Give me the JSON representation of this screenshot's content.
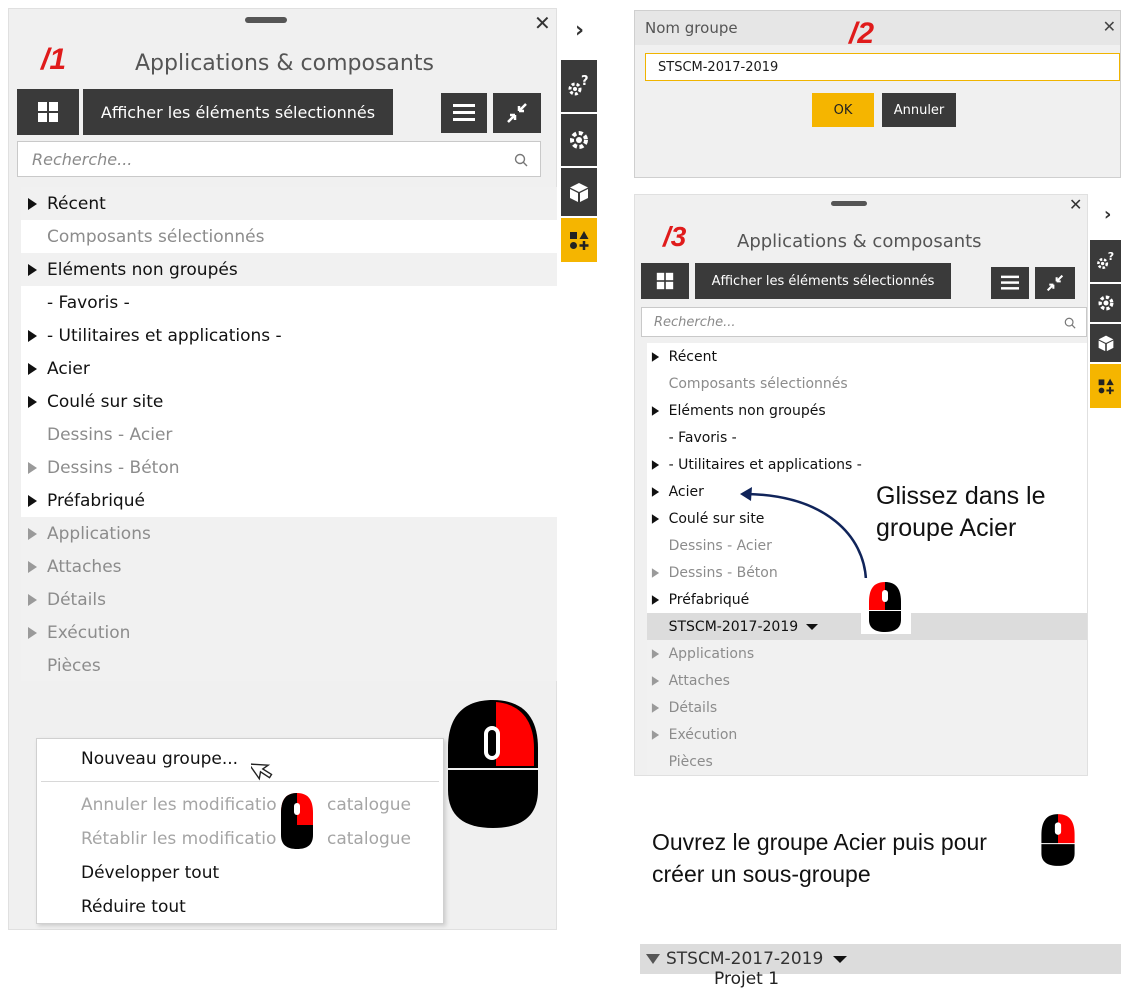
{
  "panel1": {
    "step": "/1",
    "title": "Applications & composants",
    "show_selected_label": "Afficher les éléments sélectionnés",
    "search_placeholder": "Recherche...",
    "tree": [
      {
        "label": "Récent",
        "arrow": "dark",
        "tone": "dark",
        "shade": true
      },
      {
        "label": "Composants sélectionnés",
        "arrow": "none",
        "tone": "grey",
        "shade": false
      },
      {
        "label": "Eléments non groupés",
        "arrow": "dark",
        "tone": "dark",
        "shade": true
      },
      {
        "label": "- Favoris -",
        "arrow": "none",
        "tone": "dark",
        "shade": false
      },
      {
        "label": "- Utilitaires et applications -",
        "arrow": "dark",
        "tone": "dark",
        "shade": false
      },
      {
        "label": "Acier",
        "arrow": "dark",
        "tone": "dark",
        "shade": false
      },
      {
        "label": "Coulé sur site",
        "arrow": "dark",
        "tone": "dark",
        "shade": false
      },
      {
        "label": "Dessins - Acier",
        "arrow": "none",
        "tone": "grey",
        "shade": false
      },
      {
        "label": "Dessins - Béton",
        "arrow": "grey",
        "tone": "grey",
        "shade": false
      },
      {
        "label": "Préfabriqué",
        "arrow": "dark",
        "tone": "dark",
        "shade": false
      },
      {
        "label": "Applications",
        "arrow": "grey",
        "tone": "grey",
        "shade": true
      },
      {
        "label": "Attaches",
        "arrow": "grey",
        "tone": "grey",
        "shade": true
      },
      {
        "label": "Détails",
        "arrow": "grey",
        "tone": "grey",
        "shade": true
      },
      {
        "label": "Exécution",
        "arrow": "grey",
        "tone": "grey",
        "shade": true
      },
      {
        "label": "Pièces",
        "arrow": "none",
        "tone": "grey",
        "shade": true
      }
    ],
    "context_menu": {
      "new_group": "Nouveau groupe...",
      "undo": "Annuler les modificatio",
      "undo_end": "catalogue",
      "redo": "Rétablir les modificatio",
      "redo_end": "catalogue",
      "expand_all": "Développer tout",
      "collapse_all": "Réduire tout"
    }
  },
  "dialog": {
    "step": "/2",
    "title": "Nom groupe",
    "value": "STSCM-2017-2019",
    "ok": "OK",
    "cancel": "Annuler"
  },
  "panel3": {
    "step": "/3",
    "title": "Applications & composants",
    "show_selected_label": "Afficher les éléments sélectionnés",
    "search_placeholder": "Recherche...",
    "tree": [
      {
        "label": "Récent",
        "arrow": "dark",
        "tone": "dark",
        "shade": false
      },
      {
        "label": "Composants sélectionnés",
        "arrow": "none",
        "tone": "grey",
        "shade": false
      },
      {
        "label": "Eléments non groupés",
        "arrow": "dark",
        "tone": "dark",
        "shade": false
      },
      {
        "label": "- Favoris -",
        "arrow": "none",
        "tone": "dark",
        "shade": false
      },
      {
        "label": "- Utilitaires et applications -",
        "arrow": "dark",
        "tone": "dark",
        "shade": false
      },
      {
        "label": "Acier",
        "arrow": "dark",
        "tone": "dark",
        "shade": false
      },
      {
        "label": "Coulé sur site",
        "arrow": "dark",
        "tone": "dark",
        "shade": false
      },
      {
        "label": "Dessins - Acier",
        "arrow": "none",
        "tone": "grey",
        "shade": false
      },
      {
        "label": "Dessins - Béton",
        "arrow": "grey",
        "tone": "grey",
        "shade": false
      },
      {
        "label": "Préfabriqué",
        "arrow": "dark",
        "tone": "dark",
        "shade": false
      },
      {
        "label": "STSCM-2017-2019",
        "arrow": "none",
        "tone": "dark",
        "shade": true,
        "selected": true
      },
      {
        "label": "Applications",
        "arrow": "grey",
        "tone": "grey",
        "shade": true
      },
      {
        "label": "Attaches",
        "arrow": "grey",
        "tone": "grey",
        "shade": true
      },
      {
        "label": "Détails",
        "arrow": "grey",
        "tone": "grey",
        "shade": true
      },
      {
        "label": "Exécution",
        "arrow": "grey",
        "tone": "grey",
        "shade": true
      },
      {
        "label": "Pièces",
        "arrow": "none",
        "tone": "grey",
        "shade": true
      }
    ],
    "drag_hint": "Glissez dans le groupe Acier"
  },
  "bottom": {
    "caption": "Ouvrez le groupe Acier puis pour créer un sous-groupe",
    "group_label": "STSCM-2017-2019",
    "subgroup_label": "Projet 1"
  },
  "colors": {
    "accent": "#f5b500",
    "dark_button": "#3a3a3a",
    "step_red": "#e01b1b"
  },
  "icons": [
    "grid-icon",
    "list-icon",
    "collapse-icon",
    "search-icon",
    "gear-question-icon",
    "gear-icon",
    "cube-icon",
    "shapes-plus-icon",
    "close-icon",
    "chevron-right-icon",
    "mouse-right-click-icon",
    "cursor-arrow-icon",
    "dropdown-caret-icon"
  ]
}
